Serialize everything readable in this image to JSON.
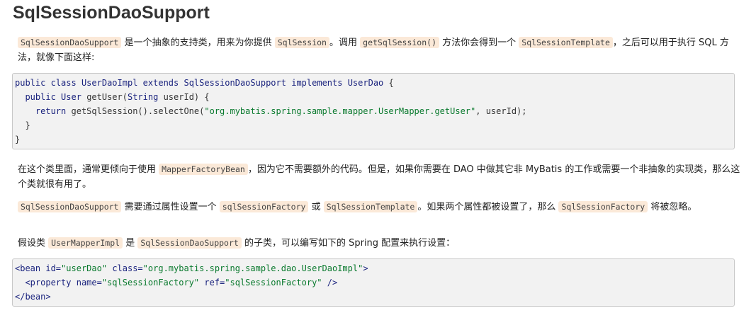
{
  "title": "SqlSessionDaoSupport",
  "p1": {
    "c1": "SqlSessionDaoSupport",
    "t1": " 是一个抽象的支持类，用来为你提供 ",
    "c2": "SqlSession",
    "t2": "。调用 ",
    "c3": "getSqlSession()",
    "t3": " 方法你会得到一个 ",
    "c4": "SqlSessionTemplate",
    "t4": "，之后可以用于执行 SQL 方法，就像下面这样:"
  },
  "code1": {
    "l1": [
      "public",
      "class",
      "UserDaoImpl",
      "extends",
      "SqlSessionDaoSupport",
      "implements",
      "UserDao",
      "{"
    ],
    "l2": [
      "public",
      "User",
      "getUser(",
      "String",
      "userId) {"
    ],
    "l3": [
      "return",
      "getSqlSession().selectOne(",
      "\"org.mybatis.spring.sample.mapper.UserMapper.getUser\"",
      ", userId);"
    ],
    "l4": "}",
    "l5": "}"
  },
  "p2": {
    "t1": "在这个类里面，通常更倾向于使用 ",
    "c1": "MapperFactoryBean",
    "t2": "，因为它不需要额外的代码。但是，如果你需要在 DAO 中做其它非 MyBatis 的工作或需要一个非抽象的实现类，那么这个类就很有用了。"
  },
  "p3": {
    "c1": "SqlSessionDaoSupport",
    "t1": " 需要通过属性设置一个 ",
    "c2": "sqlSessionFactory",
    "t2": " 或 ",
    "c3": "SqlSessionTemplate",
    "t3": "。如果两个属性都被设置了，那么 ",
    "c4": "SqlSessionFactory",
    "t4": " 将被忽略。"
  },
  "p4": {
    "t1": "假设类 ",
    "c1": "UserMapperImpl",
    "t2": " 是 ",
    "c2": "SqlSessionDaoSupport",
    "t3": " 的子类，可以编写如下的 Spring 配置来执行设置："
  },
  "code2": {
    "l1": [
      "<bean",
      "id=",
      "\"userDao\"",
      "class=",
      "\"org.mybatis.spring.sample.dao.UserDaoImpl\"",
      ">"
    ],
    "l2": [
      "<property",
      "name=",
      "\"sqlSessionFactory\"",
      "ref=",
      "\"sqlSessionFactory\"",
      "/>"
    ],
    "l3": "</bean>"
  }
}
